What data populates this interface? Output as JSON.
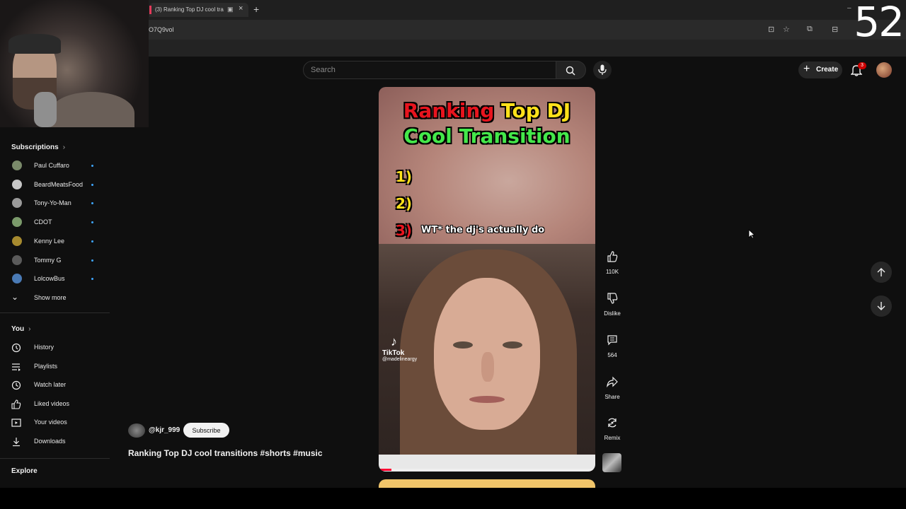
{
  "browser": {
    "tab_title": "(3) Ranking Top DJ cool tra",
    "tab_close": "×",
    "new_tab": "+",
    "url": "O7Q9vol",
    "minimize": "–"
  },
  "overlay": {
    "counter": "52"
  },
  "masthead": {
    "search_placeholder": "Search",
    "create_label": "Create",
    "notification_count": "3"
  },
  "sidebar": {
    "subscriptions_label": "Subscriptions",
    "subscriptions": [
      {
        "name": "Paul Cuffaro",
        "color": "#7a8a6a"
      },
      {
        "name": "BeardMeatsFood",
        "color": "#c7c7c7"
      },
      {
        "name": "Tony-Yo-Man",
        "color": "#9a9a9a"
      },
      {
        "name": "CDOT",
        "color": "#7b9a6b"
      },
      {
        "name": "Kenny Lee",
        "color": "#a68a2f"
      },
      {
        "name": "Tommy G",
        "color": "#5a5a5a"
      },
      {
        "name": "LolcowBus",
        "color": "#4a7ab5"
      }
    ],
    "show_more": "Show more",
    "you_label": "You",
    "you_items": [
      {
        "name": "History",
        "icon": "history-icon"
      },
      {
        "name": "Playlists",
        "icon": "playlists-icon"
      },
      {
        "name": "Watch later",
        "icon": "watch-later-icon"
      },
      {
        "name": "Liked videos",
        "icon": "liked-videos-icon"
      },
      {
        "name": "Your videos",
        "icon": "your-videos-icon"
      },
      {
        "name": "Downloads",
        "icon": "downloads-icon"
      }
    ],
    "explore_label": "Explore"
  },
  "short": {
    "title_word_red": "Ranking",
    "title_word_yellow": "Top DJ",
    "title_line2": "Cool Transition",
    "rank1": "1)",
    "rank2": "2)",
    "rank3": "3)",
    "caption": "WT* the dj's actually do",
    "watermark": "TikTok",
    "watermark_handle": "@madelineargy",
    "progress": 0.06
  },
  "actions": {
    "likes": "110K",
    "dislike": "Dislike",
    "comments": "564",
    "share": "Share",
    "remix": "Remix"
  },
  "meta": {
    "channel": "@kjr_999",
    "subscribe": "Subscribe",
    "title": "Ranking Top DJ cool transitions #shorts #music"
  },
  "colors": {
    "accent": "#ff0033",
    "live_dot": "#3ea6ff",
    "title_red": "#e8141e",
    "title_yellow": "#ffe11a",
    "title_green": "#44e84a"
  }
}
